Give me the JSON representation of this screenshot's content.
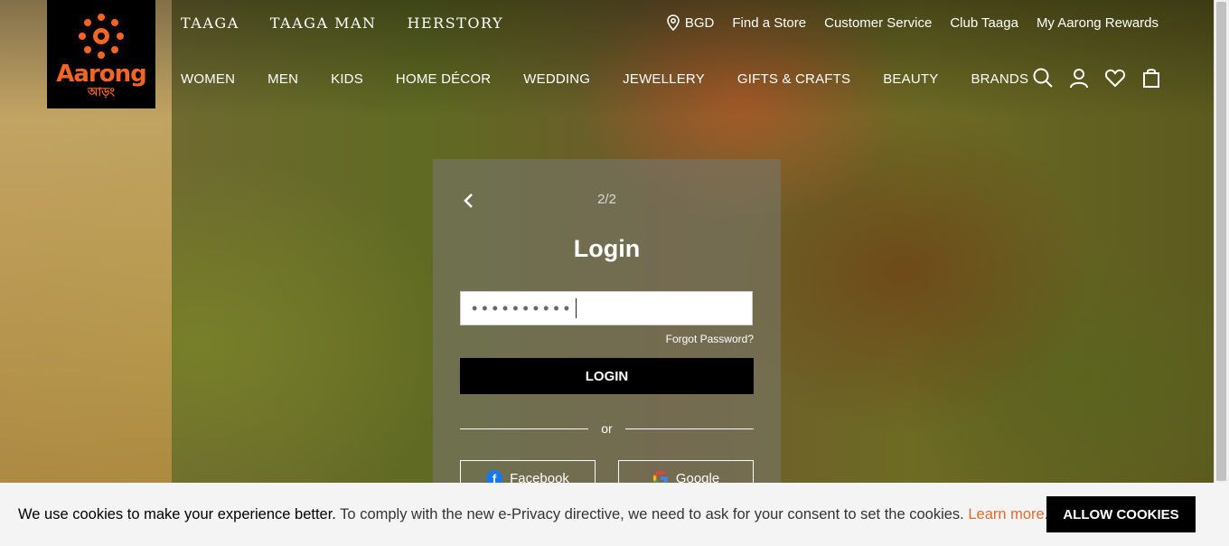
{
  "brand": {
    "name": "Aarong",
    "name_bangla": "আড়ং",
    "accent_color": "#f26522"
  },
  "top_nav": [
    "TAAGA",
    "TAAGA MAN",
    "HERSTORY"
  ],
  "utility_nav": {
    "location": "BGD",
    "links": [
      "Find a Store",
      "Customer Service",
      "Club Taaga",
      "My Aarong Rewards"
    ]
  },
  "main_nav": [
    "WOMEN",
    "MEN",
    "KIDS",
    "HOME DÉCOR",
    "WEDDING",
    "JEWELLERY",
    "GIFTS & CRAFTS",
    "BEAUTY",
    "BRANDS"
  ],
  "header_icons": [
    "search-icon",
    "account-icon",
    "wishlist-icon",
    "cart-icon"
  ],
  "login": {
    "step": "2/2",
    "title": "Login",
    "password_value": "••••••••••",
    "forgot_label": "Forgot Password?",
    "login_button": "LOGIN",
    "or_label": "or",
    "facebook_label": "Facebook",
    "google_label": "Google"
  },
  "cookie": {
    "lead": "We use cookies to make your experience better.",
    "body": " To comply with the new e-Privacy directive, we need to ask for your consent to set the cookies. ",
    "link": "Learn more",
    "tail": ".",
    "button": "ALLOW COOKIES"
  }
}
